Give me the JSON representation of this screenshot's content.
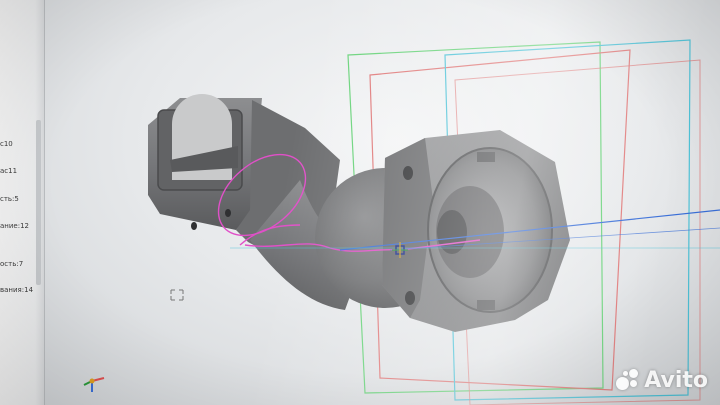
{
  "tree": {
    "items": [
      {
        "label": "с10"
      },
      {
        "label": "ас11"
      },
      {
        "label": "сть:5"
      },
      {
        "label": "ание:12"
      },
      {
        "label": "ость:7"
      },
      {
        "label": "вания:14"
      }
    ]
  },
  "watermark": {
    "brand": "Avito"
  },
  "colors": {
    "model": "#7f8082",
    "plane_red": "#e07a7a",
    "plane_green": "#69d37a",
    "plane_cyan": "#4fc3d8",
    "sketch": "#e050c8",
    "axis_blue": "#3a6fd8"
  },
  "icons": {
    "triad": "triad-icon",
    "origin": "origin-marker-icon",
    "logo": "avito-logo-icon"
  }
}
